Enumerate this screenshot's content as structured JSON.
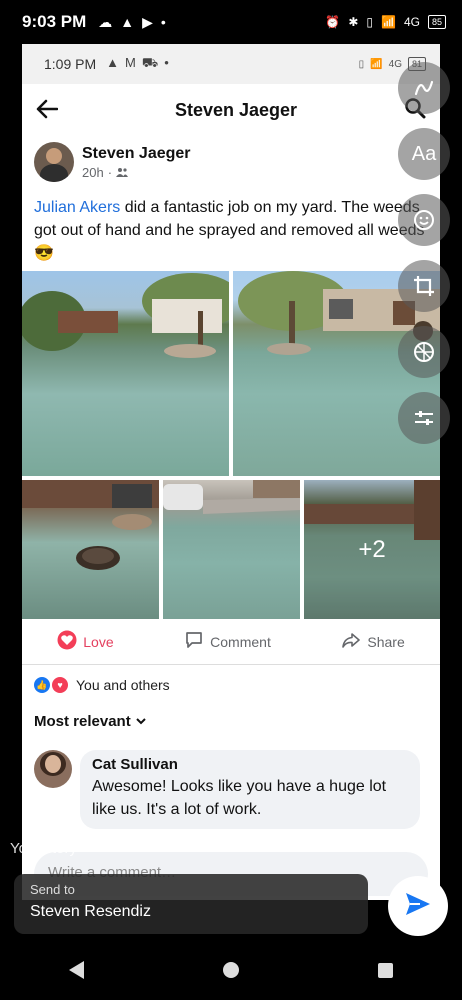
{
  "outer_status": {
    "time": "9:03 PM",
    "battery": "85",
    "network": "4G"
  },
  "inner_status": {
    "time": "1:09 PM",
    "battery": "81",
    "network": "4G"
  },
  "header": {
    "title": "Steven Jaeger"
  },
  "post": {
    "author": "Steven Jaeger",
    "time": "20h",
    "mention": "Julian Akers",
    "text": " did a fantastic job on my yard. The weeds got out of hand and he sprayed and removed all weeds",
    "emoji": "😎",
    "more_photos": "+2"
  },
  "actions": {
    "love": "Love",
    "comment": "Comment",
    "share": "Share"
  },
  "reactions": {
    "text": "You and others"
  },
  "sort": {
    "label": "Most relevant"
  },
  "comment": {
    "name": "Cat Sullivan",
    "text": "Awesome! Looks like you have a huge lot like us. It's a lot of work."
  },
  "write_placeholder": "Write a comment…",
  "tools": {
    "text": "Aa"
  },
  "overlay": {
    "your_story": "Your story",
    "send_to": "Send to",
    "recipient": "Steven Resendiz"
  },
  "icons": [
    "back-arrow-icon",
    "search-icon",
    "friends-icon",
    "love-icon",
    "comment-icon",
    "share-icon",
    "chevron-down-icon",
    "send-icon",
    "draw-icon",
    "sticker-icon",
    "crop-icon",
    "filter-icon",
    "adjust-icon"
  ],
  "colors": {
    "accent": "#1877f2",
    "love": "#e4405f",
    "mention": "#216fdb"
  }
}
